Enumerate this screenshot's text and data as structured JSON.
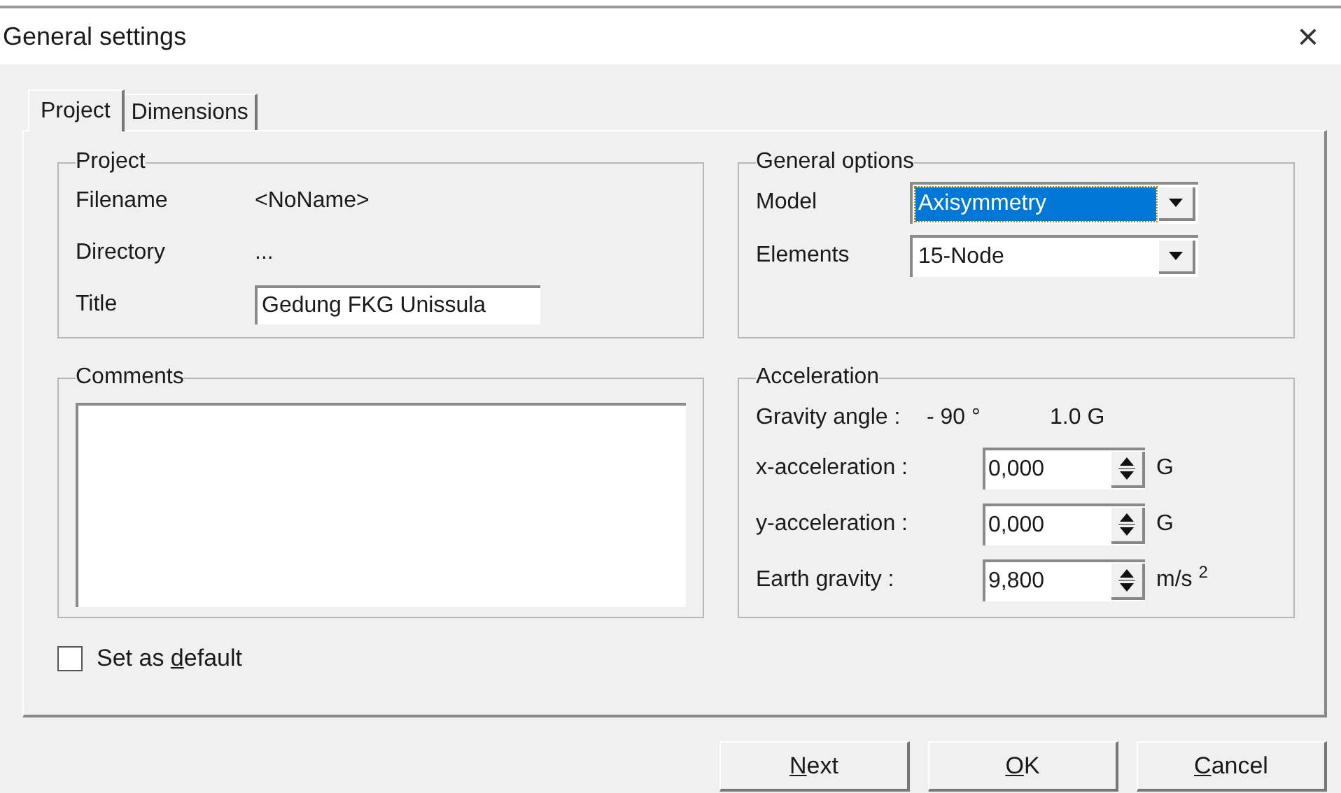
{
  "window": {
    "title": "General settings",
    "close": "×"
  },
  "tabs": [
    {
      "label": "Project",
      "selected": true
    },
    {
      "label": "Dimensions",
      "selected": false
    }
  ],
  "project": {
    "legend": "Project",
    "rows": [
      {
        "kind": "text",
        "label": "Filename",
        "value": "<NoName>"
      },
      {
        "kind": "text",
        "label": "Directory",
        "value": "..."
      },
      {
        "kind": "input",
        "label": "Title",
        "value": "Gedung FKG Unissula"
      }
    ]
  },
  "comments": {
    "legend": "Comments"
  },
  "general_options": {
    "legend": "General options",
    "rows": [
      {
        "label": "Model",
        "value": "Axisymmetry",
        "focused": true
      },
      {
        "label": "Elements",
        "value": "15-Node",
        "focused": false
      }
    ]
  },
  "acceleration": {
    "legend": "Acceleration",
    "gravity_label": "Gravity angle :",
    "gravity_angle": "- 90 °",
    "gravity_value": "1.0 G",
    "rows": [
      {
        "label": "x-acceleration :",
        "value": "0,000",
        "unit": "G"
      },
      {
        "label": "y-acceleration :",
        "value": "0,000",
        "unit": "G"
      },
      {
        "label": "Earth gravity :",
        "value": "9,800",
        "unit": "m/s $^{2}$"
      }
    ]
  },
  "set_as_default": {
    "label": {
      "before": "Set as ",
      "access_key": "d",
      "after": "efault"
    },
    "checked": false
  },
  "buttons": [
    {
      "label": {
        "access_key": "N",
        "after": "ext"
      }
    },
    {
      "label": {
        "access_key": "O",
        "after": "K"
      }
    },
    {
      "label": {
        "access_key": "C",
        "after": "ancel"
      }
    }
  ]
}
